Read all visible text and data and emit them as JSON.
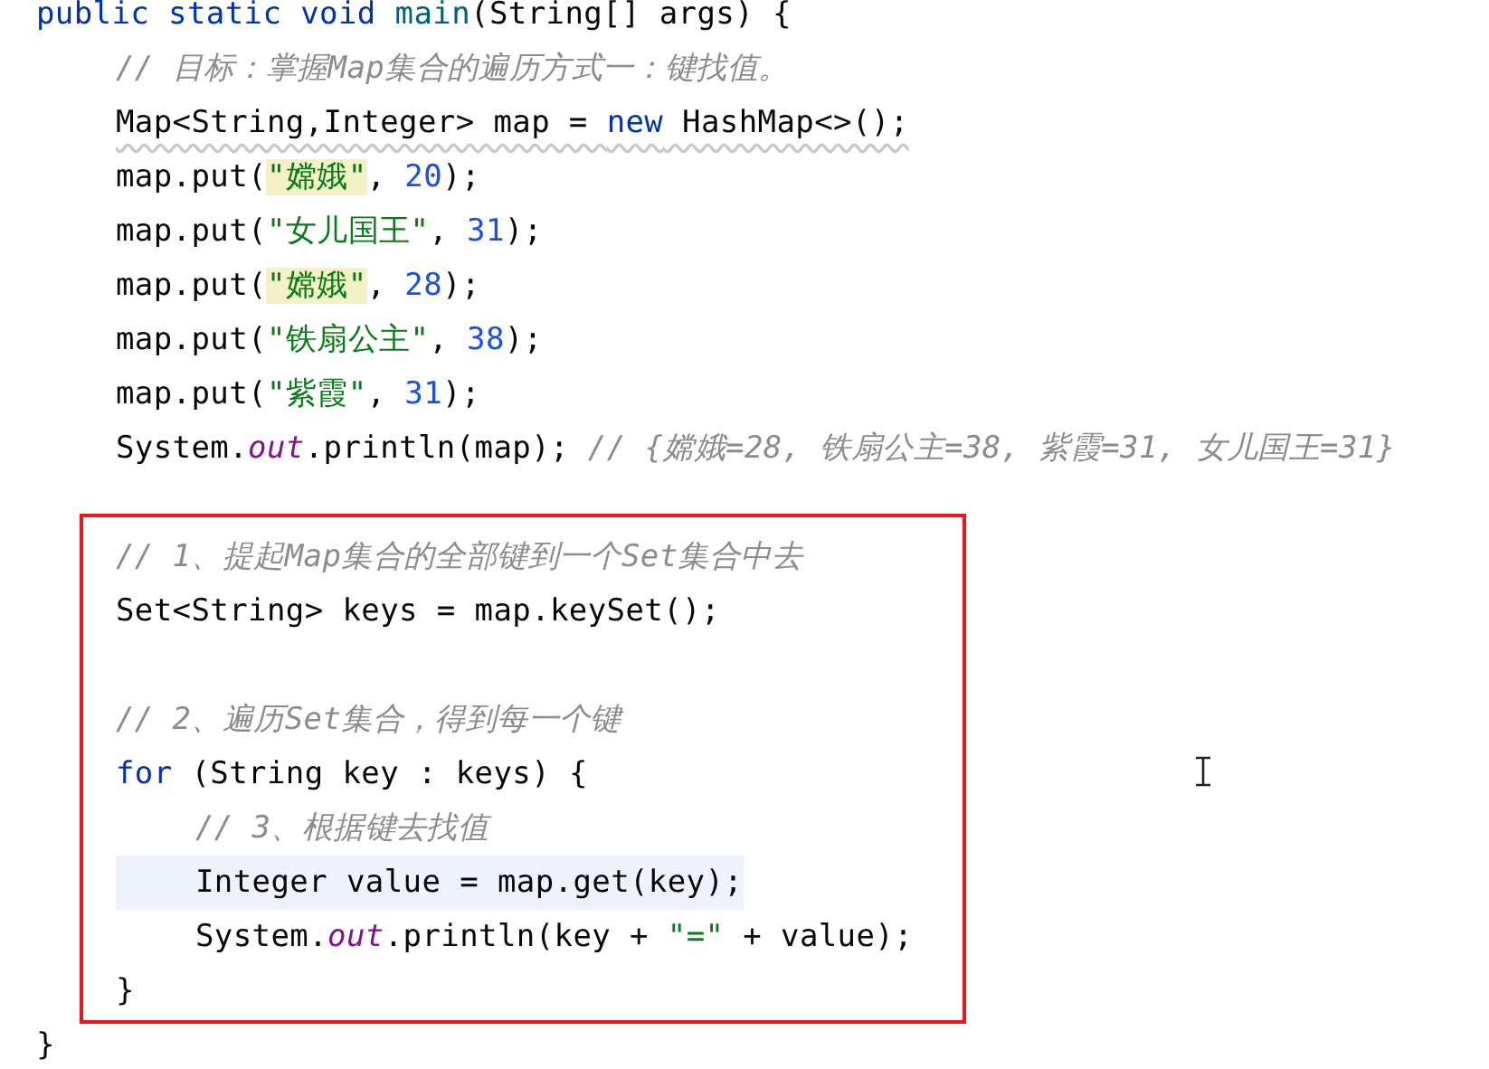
{
  "method": {
    "header": [
      {
        "kind": "keyword",
        "text": "public static void "
      },
      {
        "kind": "method",
        "text": "main"
      },
      {
        "kind": "plain",
        "text": "(String[] args) {"
      }
    ],
    "body": [
      {
        "kind": "code",
        "tokens": [
          {
            "kind": "comment",
            "text": "// 目标：掌握Map集合的遍历方式一：键找值。"
          }
        ]
      },
      {
        "kind": "code",
        "warning": true,
        "tokens": [
          {
            "kind": "plain",
            "text": "Map<String,Integer> map = "
          },
          {
            "kind": "keyword",
            "text": "new"
          },
          {
            "kind": "plain",
            "text": " HashMap<>();"
          }
        ]
      },
      {
        "kind": "code",
        "tokens": [
          {
            "kind": "plain",
            "text": "map.put("
          },
          {
            "kind": "match",
            "text": "\"嫦娥\""
          },
          {
            "kind": "plain",
            "text": ", "
          },
          {
            "kind": "number",
            "text": "20"
          },
          {
            "kind": "plain",
            "text": ");"
          }
        ]
      },
      {
        "kind": "code",
        "tokens": [
          {
            "kind": "plain",
            "text": "map.put("
          },
          {
            "kind": "string",
            "text": "\"女儿国王\""
          },
          {
            "kind": "plain",
            "text": ", "
          },
          {
            "kind": "number",
            "text": "31"
          },
          {
            "kind": "plain",
            "text": ");"
          }
        ]
      },
      {
        "kind": "code",
        "tokens": [
          {
            "kind": "plain",
            "text": "map.put("
          },
          {
            "kind": "match",
            "text": "\"嫦娥\""
          },
          {
            "kind": "plain",
            "text": ", "
          },
          {
            "kind": "number",
            "text": "28"
          },
          {
            "kind": "plain",
            "text": ");"
          }
        ]
      },
      {
        "kind": "code",
        "tokens": [
          {
            "kind": "plain",
            "text": "map.put("
          },
          {
            "kind": "string",
            "text": "\"铁扇公主\""
          },
          {
            "kind": "plain",
            "text": ", "
          },
          {
            "kind": "number",
            "text": "38"
          },
          {
            "kind": "plain",
            "text": ");"
          }
        ]
      },
      {
        "kind": "code",
        "tokens": [
          {
            "kind": "plain",
            "text": "map.put("
          },
          {
            "kind": "string",
            "text": "\"紫霞\""
          },
          {
            "kind": "plain",
            "text": ", "
          },
          {
            "kind": "number",
            "text": "31"
          },
          {
            "kind": "plain",
            "text": ");"
          }
        ]
      },
      {
        "kind": "code",
        "tokens": [
          {
            "kind": "plain",
            "text": "System."
          },
          {
            "kind": "field",
            "text": "out"
          },
          {
            "kind": "plain",
            "text": ".println(map); "
          },
          {
            "kind": "comment",
            "text": "// {嫦娥=28, 铁扇公主=38, 紫霞=31, 女儿国王=31}"
          }
        ]
      },
      {
        "kind": "blank"
      }
    ],
    "highlight_box": [
      {
        "kind": "code",
        "tokens": [
          {
            "kind": "comment",
            "text": "// 1、提起Map集合的全部键到一个Set集合中去"
          }
        ]
      },
      {
        "kind": "code",
        "tokens": [
          {
            "kind": "plain",
            "text": "Set<String> keys = map.keySet();"
          }
        ]
      },
      {
        "kind": "blank"
      },
      {
        "kind": "code",
        "tokens": [
          {
            "kind": "comment",
            "text": "// 2、遍历Set集合，得到每一个键"
          }
        ]
      },
      {
        "kind": "code",
        "tokens": [
          {
            "kind": "keyword",
            "text": "for"
          },
          {
            "kind": "plain",
            "text": " (String key : keys) {"
          }
        ],
        "children": [
          {
            "kind": "code",
            "tokens": [
              {
                "kind": "comment",
                "text": "// 3、根据键去找值"
              }
            ]
          },
          {
            "kind": "code",
            "current": true,
            "tokens": [
              {
                "kind": "plain",
                "text": "Integer value = map.get(key);"
              }
            ]
          },
          {
            "kind": "code",
            "tokens": [
              {
                "kind": "plain",
                "text": "System."
              },
              {
                "kind": "field",
                "text": "out"
              },
              {
                "kind": "plain",
                "text": ".println(key + "
              },
              {
                "kind": "string",
                "text": "\"=\""
              },
              {
                "kind": "plain",
                "text": " + value);"
              }
            ]
          }
        ],
        "closing": [
          {
            "kind": "plain",
            "text": "}"
          }
        ]
      }
    ],
    "closing": [
      {
        "kind": "plain",
        "text": "}"
      }
    ]
  }
}
